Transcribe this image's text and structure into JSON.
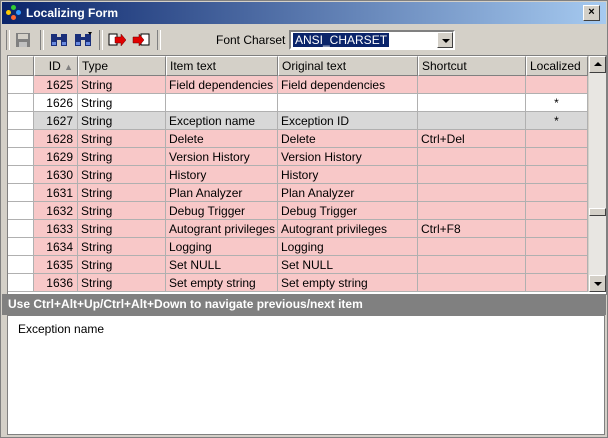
{
  "window": {
    "title": "Localizing Form",
    "close_glyph": "×"
  },
  "toolbar": {
    "buttons": [
      {
        "name": "save-button",
        "icon": "floppy-disk-icon"
      },
      {
        "name": "find-button",
        "icon": "binoculars-icon"
      },
      {
        "name": "find-next-button",
        "icon": "binoculars-next-icon"
      },
      {
        "name": "export-button",
        "icon": "export-arrow-icon"
      },
      {
        "name": "import-button",
        "icon": "import-arrow-icon"
      }
    ],
    "charset_label": "Font Charset",
    "charset_value": "ANSI_CHARSET"
  },
  "grid": {
    "columns": [
      "ID",
      "Type",
      "Item text",
      "Original text",
      "Shortcut",
      "Localized"
    ],
    "sort_indicator": "▲",
    "rows": [
      {
        "id": "1625",
        "type": "String",
        "item": "Field dependencies",
        "orig": "Field dependencies",
        "shortcut": "",
        "localized": "",
        "style": "pink"
      },
      {
        "id": "1626",
        "type": "String",
        "item": "",
        "orig": "",
        "shortcut": "",
        "localized": "*",
        "style": "white"
      },
      {
        "id": "1627",
        "type": "String",
        "item": "Exception name",
        "orig": "Exception ID",
        "shortcut": "",
        "localized": "*",
        "style": "selected"
      },
      {
        "id": "1628",
        "type": "String",
        "item": "Delete",
        "orig": "Delete",
        "shortcut": "Ctrl+Del",
        "localized": "",
        "style": "pink"
      },
      {
        "id": "1629",
        "type": "String",
        "item": "Version History",
        "orig": "Version History",
        "shortcut": "",
        "localized": "",
        "style": "pink"
      },
      {
        "id": "1630",
        "type": "String",
        "item": "History",
        "orig": "History",
        "shortcut": "",
        "localized": "",
        "style": "pink"
      },
      {
        "id": "1631",
        "type": "String",
        "item": "Plan Analyzer",
        "orig": "Plan Analyzer",
        "shortcut": "",
        "localized": "",
        "style": "pink"
      },
      {
        "id": "1632",
        "type": "String",
        "item": "Debug Trigger",
        "orig": "Debug Trigger",
        "shortcut": "",
        "localized": "",
        "style": "pink"
      },
      {
        "id": "1633",
        "type": "String",
        "item": "Autogrant privileges",
        "orig": "Autogrant privileges",
        "shortcut": "Ctrl+F8",
        "localized": "",
        "style": "pink"
      },
      {
        "id": "1634",
        "type": "String",
        "item": "Logging",
        "orig": "Logging",
        "shortcut": "",
        "localized": "",
        "style": "pink"
      },
      {
        "id": "1635",
        "type": "String",
        "item": "Set NULL",
        "orig": "Set NULL",
        "shortcut": "",
        "localized": "",
        "style": "pink"
      },
      {
        "id": "1636",
        "type": "String",
        "item": "Set empty string",
        "orig": "Set empty string",
        "shortcut": "",
        "localized": "",
        "style": "pink"
      }
    ]
  },
  "status": {
    "hint": "Use Ctrl+Alt+Up/Ctrl+Alt+Down to navigate previous/next item"
  },
  "detail": {
    "text": "Exception name"
  },
  "colors": {
    "pink": "#f8c8c8",
    "selected": "#d8d8d8",
    "white": "#ffffff"
  }
}
